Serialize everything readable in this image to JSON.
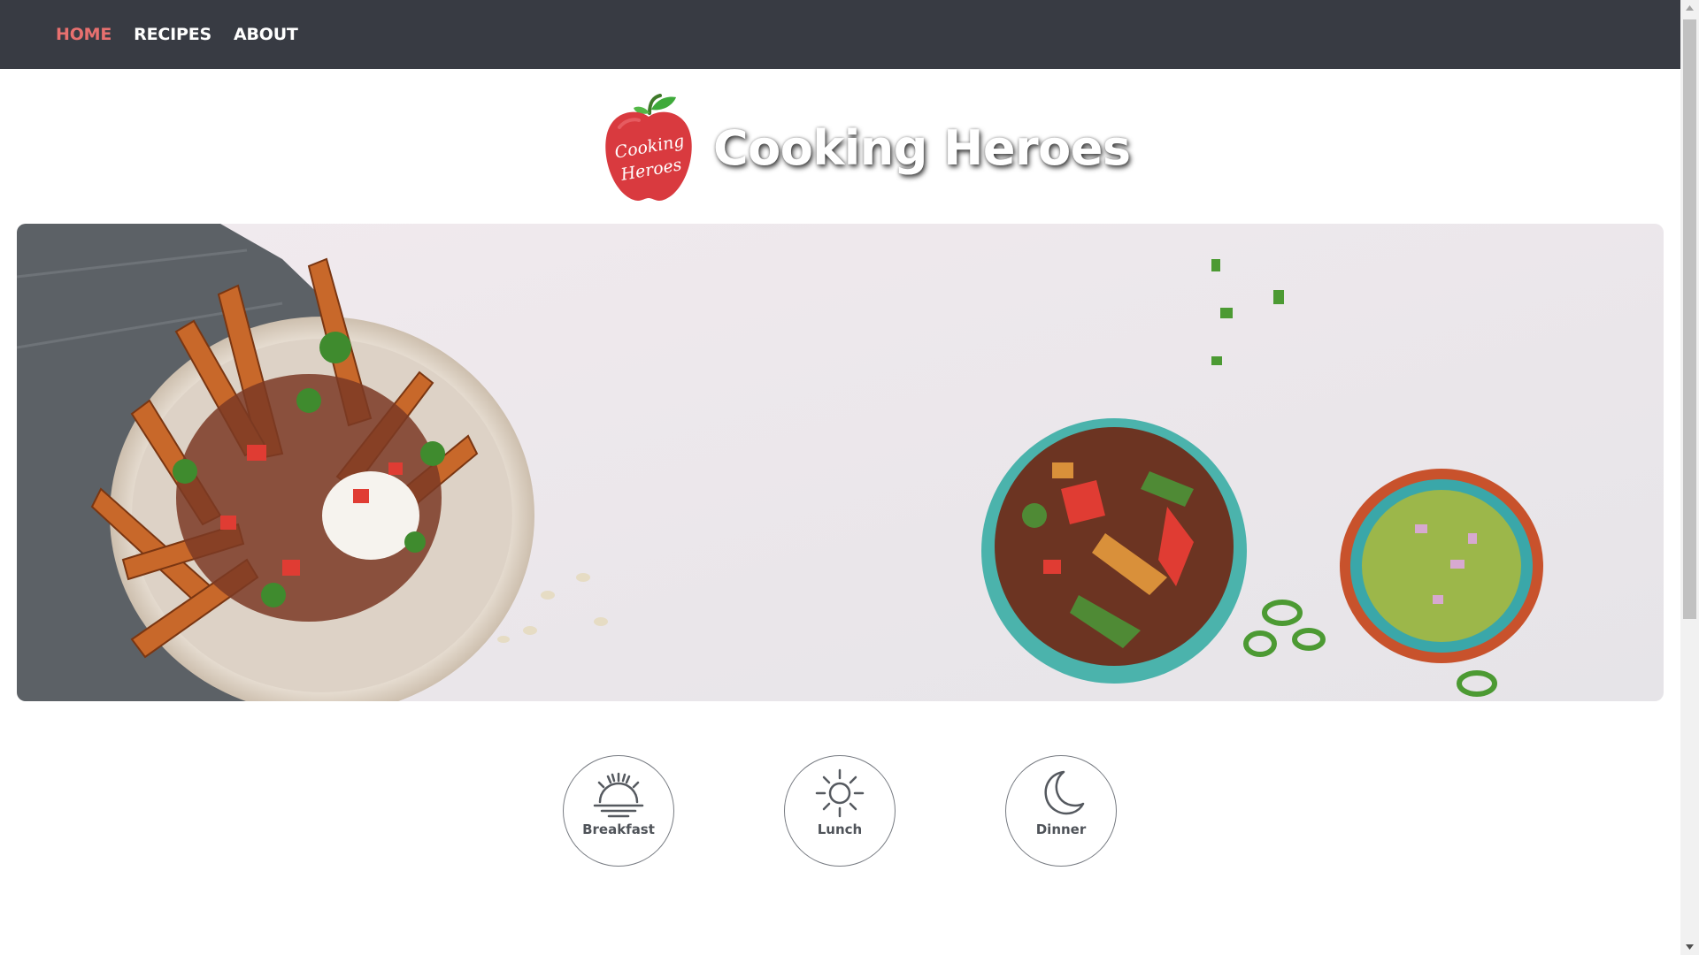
{
  "nav": {
    "items": [
      {
        "label": "HOME",
        "active": true
      },
      {
        "label": "RECIPES",
        "active": false
      },
      {
        "label": "ABOUT",
        "active": false
      }
    ],
    "background": "#383b43",
    "active_color": "#e8706f"
  },
  "brand": {
    "logo_text_line1": "Cooking",
    "logo_text_line2": "Heroes",
    "title": "Cooking Heroes",
    "logo_color": "#d93a3f"
  },
  "hero": {
    "icon": "food-bowls-photo"
  },
  "meals": [
    {
      "label": "Breakfast",
      "icon": "sunrise-icon"
    },
    {
      "label": "Lunch",
      "icon": "sun-icon"
    },
    {
      "label": "Dinner",
      "icon": "moon-icon"
    }
  ]
}
